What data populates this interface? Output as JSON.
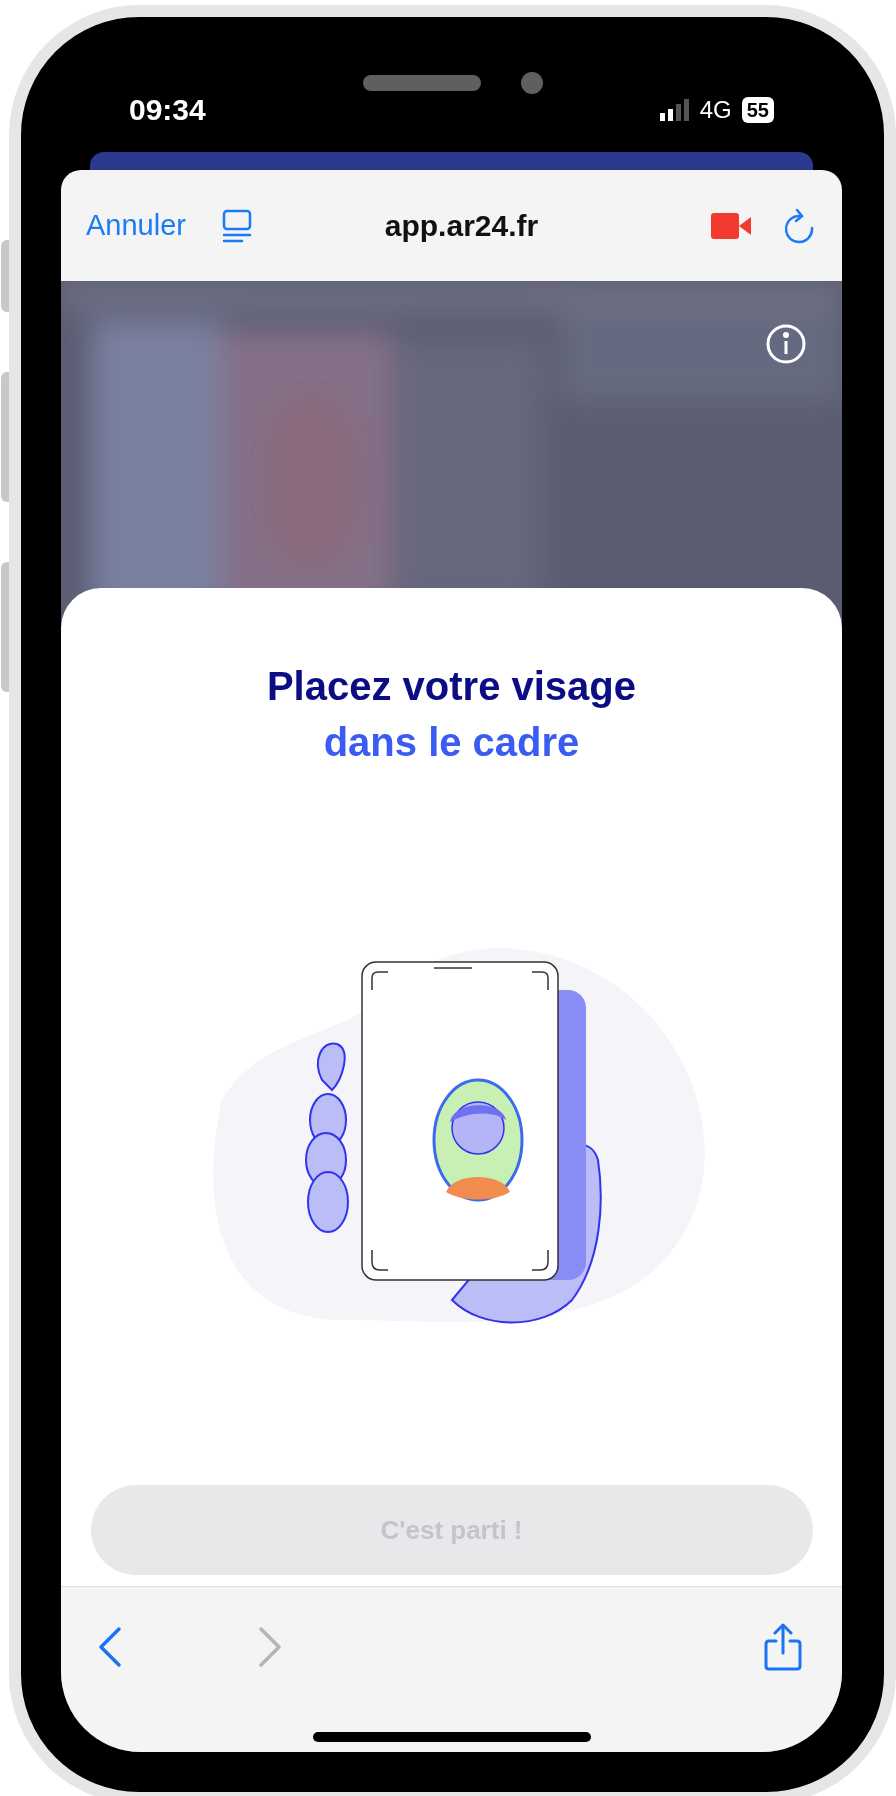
{
  "status_bar": {
    "time": "09:34",
    "network": "4G",
    "battery": "55"
  },
  "browser_bar": {
    "cancel": "Annuler",
    "url": "app.ar24.fr",
    "recording": true
  },
  "card": {
    "title": "Placez votre visage",
    "subtitle": "dans le cadre"
  },
  "button": {
    "label": "C'est parti !",
    "disabled": true
  },
  "toolbar": {
    "back": {
      "disabled": false
    },
    "forward": {
      "disabled": true
    }
  }
}
